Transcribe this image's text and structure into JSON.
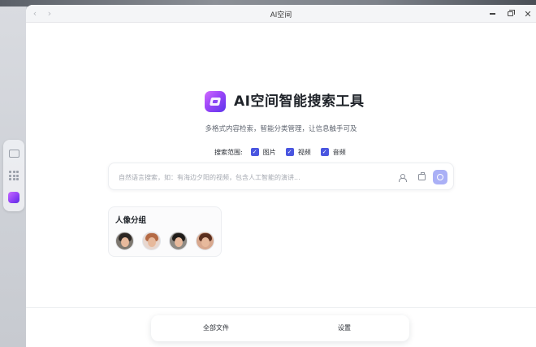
{
  "window": {
    "title": "AI空间"
  },
  "hero": {
    "title": "AI空间智能搜索工具",
    "subtitle": "多格式内容检索，智能分类管理，让信息触手可及"
  },
  "scope": {
    "label": "搜索范围:",
    "options": [
      {
        "label": "图片",
        "checked": true
      },
      {
        "label": "视频",
        "checked": true
      },
      {
        "label": "音频",
        "checked": true
      }
    ]
  },
  "search": {
    "placeholder": "自然语言搜索，如：有海边夕阳的视频，包含人工智能的演讲...",
    "value": ""
  },
  "person_group": {
    "title": "人像分组",
    "avatar_count": 4
  },
  "bottom_nav": {
    "all_files": "全部文件",
    "settings": "设置"
  },
  "colors": {
    "accent": "#4a56e0",
    "search_button": "#aab0f6",
    "logo_gradient": [
      "#d26bff",
      "#5d35ec"
    ]
  },
  "icons": {
    "back": "chevron-left-icon",
    "forward": "chevron-right-icon",
    "minimize": "minimize-icon",
    "maximize": "restore-icon",
    "close": "close-icon",
    "person_search": "person-icon",
    "library": "library-icon",
    "search": "search-icon"
  }
}
